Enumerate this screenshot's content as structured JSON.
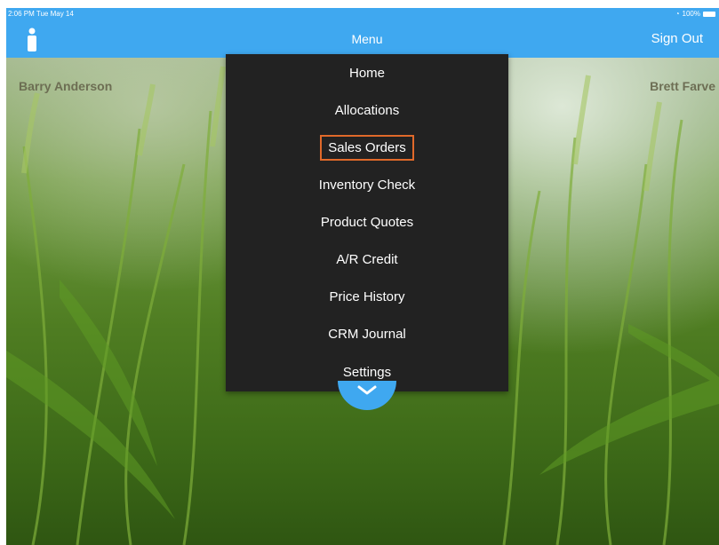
{
  "status_bar": {
    "time": "2:06 PM  Tue May 14",
    "battery": "100%"
  },
  "nav": {
    "title": "Menu",
    "sign_out": "Sign Out"
  },
  "users": {
    "left": "Barry Anderson",
    "right": "Brett Farve"
  },
  "menu": {
    "items": [
      {
        "label": "Home"
      },
      {
        "label": "Allocations"
      },
      {
        "label": "Sales Orders"
      },
      {
        "label": "Inventory Check"
      },
      {
        "label": "Product Quotes"
      },
      {
        "label": "A/R Credit"
      },
      {
        "label": "Price History"
      },
      {
        "label": "CRM Journal"
      },
      {
        "label": "Settings"
      }
    ],
    "highlighted_index": 2
  },
  "colors": {
    "nav_blue": "#3fa8f0",
    "menu_bg": "#222222",
    "highlight": "#e0692a"
  },
  "icons": {
    "user": "person-icon",
    "collapse": "chevron-down-icon",
    "wifi": "wifi-icon",
    "battery": "battery-icon"
  }
}
